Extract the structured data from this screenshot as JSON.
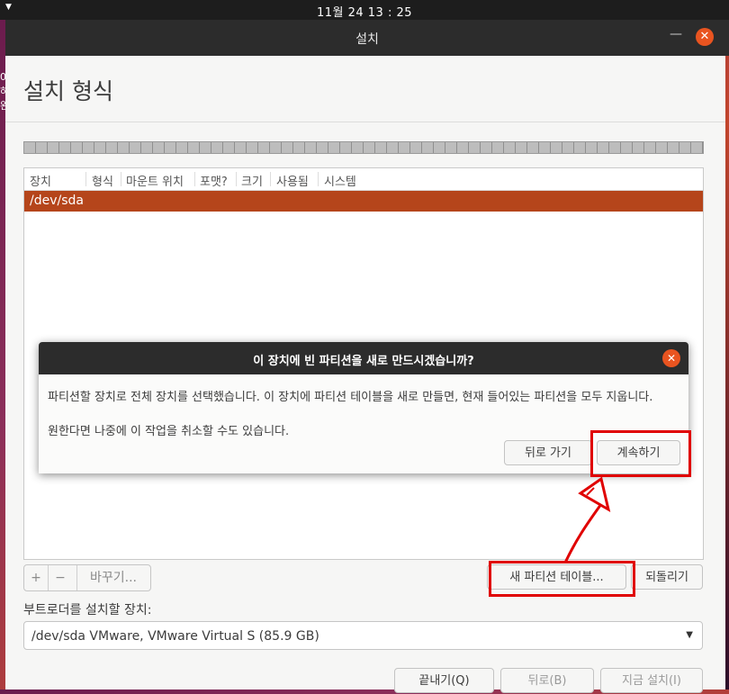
{
  "topbar": {
    "clock": "11월 24  13 : 25"
  },
  "desktop": {
    "edge_chars": "0\n하\n완"
  },
  "window": {
    "title": "설치",
    "minimize_glyph": "—",
    "close_glyph": "✕"
  },
  "page": {
    "title": "설치 형식"
  },
  "table": {
    "headers": [
      "장치",
      "형식",
      "마운트 위치",
      "포맷?",
      "크기",
      "사용됨",
      "시스템"
    ],
    "rows": [
      {
        "device": "/dev/sda"
      }
    ]
  },
  "toolbar": {
    "add": "+",
    "remove": "−",
    "change": "바꾸기..."
  },
  "buttons": {
    "new_partition_table": "새 파티션 테이블...",
    "revert": "되돌리기",
    "quit": "끝내기(Q)",
    "back": "뒤로(B)",
    "install_now": "지금 설치(I)"
  },
  "bootloader": {
    "label": "부트로더를 설치할 장치:",
    "value": "/dev/sda VMware, VMware Virtual S (85.9 GB)"
  },
  "dialog": {
    "title": "이 장치에 빈 파티션을 새로 만드시겠습니까?",
    "line1": "파티션할 장치로 전체 장치를 선택했습니다. 이 장치에 파티션 테이블을 새로 만들면, 현재 들어있는 파티션을 모두 지웁니다.",
    "line2": "원한다면 나중에 이 작업을 취소할 수도 있습니다.",
    "back": "뒤로 가기",
    "continue": "계속하기"
  },
  "colors": {
    "accent": "#e95420",
    "selection": "#b5451b",
    "annotation": "#e00000"
  }
}
